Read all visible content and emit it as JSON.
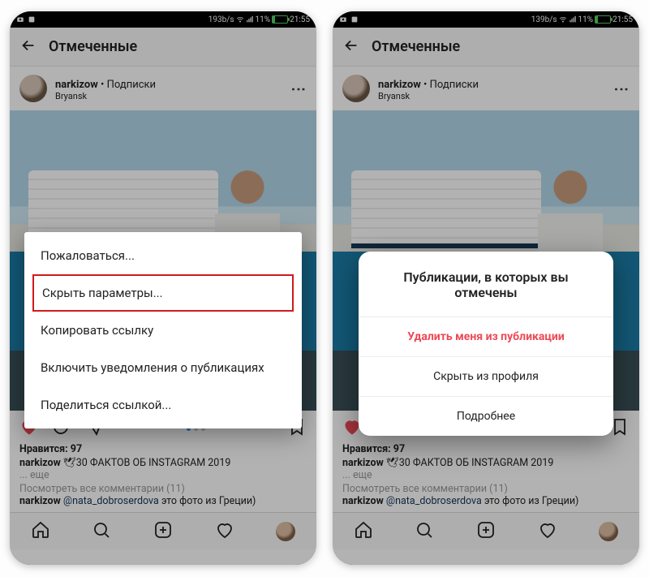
{
  "status": {
    "speed_left": "193b/s",
    "speed_right": "139b/s",
    "battery_pct": "11%",
    "time": "21:55"
  },
  "header": {
    "title": "Отмеченные"
  },
  "post": {
    "username": "narkizow",
    "subscription_sep": " • ",
    "subscription": "Подписки",
    "location": "Bryansk"
  },
  "caption": {
    "likes_label": "Нравится: 97",
    "username": "narkizow",
    "text": " 🕊30 ФАКТОВ ОБ INSTAGRAM 2019",
    "more": "... еще",
    "all_comments": "Посмотреть все комментарии (11)",
    "c_user": "narkizow",
    "c_mention": "@nata_dobroserdova",
    "c_rest": " это фото из Греции)"
  },
  "menu": {
    "items": [
      "Пожаловаться...",
      "Скрыть параметры...",
      "Копировать ссылку",
      "Включить уведомления о публикациях",
      "Поделиться ссылкой..."
    ],
    "highlight_index": 1
  },
  "dialog": {
    "title": "Публикации, в которых вы отмечены",
    "options": [
      "Удалить меня из публикации",
      "Скрыть из профиля",
      "Подробнее"
    ],
    "danger_index": 0
  }
}
